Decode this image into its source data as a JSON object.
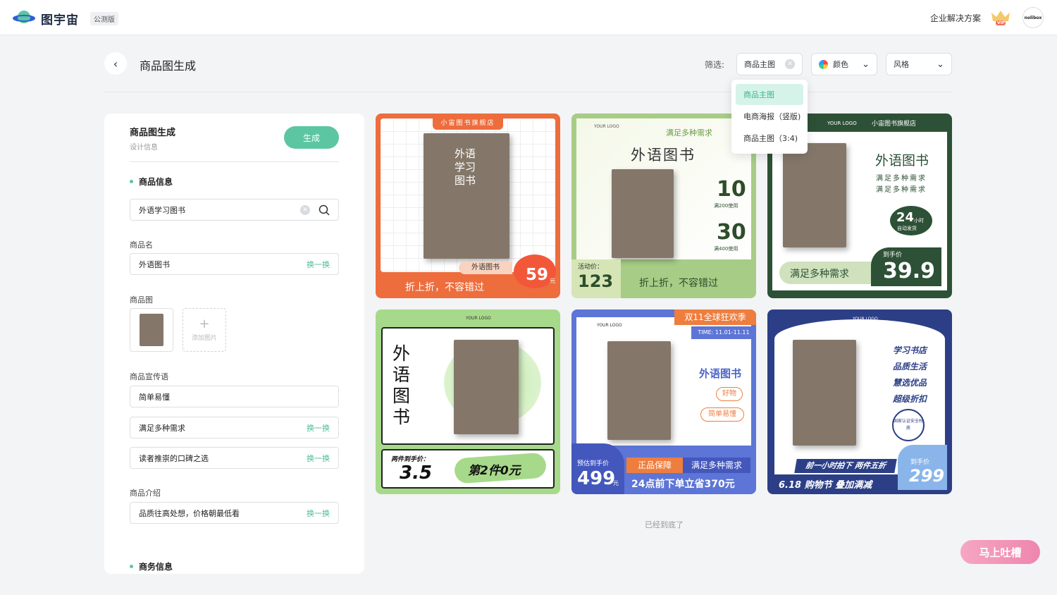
{
  "header": {
    "brand": "图宇宙",
    "beta": "公测版",
    "enterprise": "企业解决方案",
    "vip": "VIP",
    "avatar": "nolibox"
  },
  "page": {
    "title": "商品图生成",
    "filter_label": "筛选:",
    "empty_end": "已经到底了"
  },
  "filters": {
    "type_value": "商品主图",
    "color_label": "颜色",
    "style_label": "风格"
  },
  "dropdown": {
    "options": [
      "商品主图",
      "电商海报（竖版)",
      "商品主图（3:4)"
    ],
    "selected_index": 0
  },
  "panel": {
    "title": "商品图生成",
    "subtitle": "设计信息",
    "generate": "生成",
    "sec_product": "商品信息",
    "search_value": "外语学习图书",
    "name_label": "商品名",
    "name_value": "外语图书",
    "img_label": "商品图",
    "add_image": "添加图片",
    "slogan_label": "商品宣传语",
    "slogan1": "简单易懂",
    "slogan2": "满足多种需求",
    "slogan3": "读者推崇的口碑之选",
    "intro_label": "商品介绍",
    "intro_value": "品质往高处想，价格朝最低看",
    "swap": "换一换",
    "sec_business": "商务信息"
  },
  "cards": {
    "c1": {
      "store": "小宙图书旗舰店",
      "tag": "外语图书",
      "price": "59",
      "unit": "元",
      "slogan": "折上折，不容错过"
    },
    "c2": {
      "logo": "YOUR LOGO",
      "head": "满足多种需求",
      "title": "外语图书",
      "c10": "10",
      "c10_label": "满200使用",
      "c30": "30",
      "c30_label": "满400使用",
      "price_label": "活动价：",
      "price": "123",
      "slogan": "折上折，不容错过"
    },
    "c3": {
      "logo": "YOUR LOGO",
      "store": "小宙图书旗舰店",
      "title": "外语图书",
      "sub1": "满足多种需求",
      "sub2": "满足多种需求",
      "hours": "24",
      "hours_unit": "小时",
      "hours_sub": "自动发货",
      "price_label": "到手价",
      "price": "39.9",
      "slogan": "满足多种需求"
    },
    "c4": {
      "logo": "YOUR LOGO",
      "vtitle": "外语图书",
      "price_label": "两件到手价：",
      "price": "3.5",
      "promo": "第2件0元"
    },
    "c5": {
      "logo": "YOUR LOGO",
      "top": "双11全球狂欢季",
      "time": "TIME: 11.01-11.11",
      "title": "外语图书",
      "tag1": "好物",
      "tag2": "简单易懂",
      "price_label": "预估到手价",
      "price": "499",
      "unit": "元",
      "g1": "正品保障",
      "g2": "满足多种需求",
      "bottom": "24点前下单立省370元"
    },
    "c6": {
      "logo": "YOUR LOGO",
      "l1": "学习书店",
      "l2": "品质生活",
      "l3": "慧选优品",
      "l4": "超级折扣",
      "badge": "国家认证安全材质",
      "banner": "前一小时拍下 两件五折",
      "bottom": "6.18 购物节  叠加满减",
      "price_label": "到手价",
      "price": "299"
    }
  },
  "book": {
    "title": "外语学习图书"
  },
  "feedback": "马上吐槽"
}
